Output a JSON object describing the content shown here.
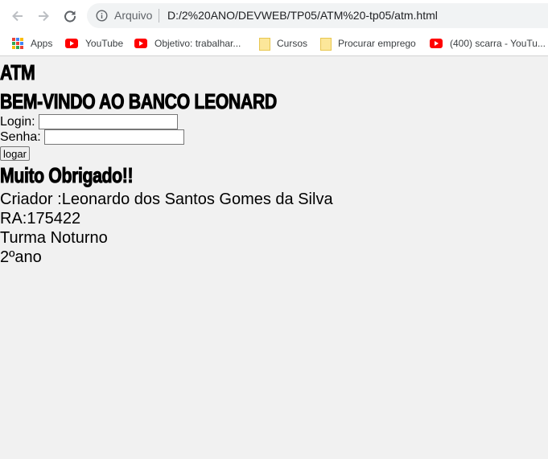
{
  "browser": {
    "scheme_label": "Arquivo",
    "url": "D:/2%20ANO/DEVWEB/TP05/ATM%20-tp05/atm.html",
    "bookmarks": [
      {
        "label": "Apps",
        "icon": "apps-grid-icon"
      },
      {
        "label": "YouTube",
        "icon": "youtube-icon"
      },
      {
        "label": "Objetivo: trabalhar...",
        "icon": "youtube-icon"
      },
      {
        "label": "Cursos",
        "icon": "folder-icon"
      },
      {
        "label": "Procurar emprego",
        "icon": "folder-icon"
      },
      {
        "label": "(400) scarra - YouTu...",
        "icon": "youtube-icon"
      }
    ]
  },
  "page": {
    "atm_title": "ATM",
    "welcome_title": "BEM-VINDO AO BANCO LEONARD",
    "login_label": "Login:",
    "login_value": "",
    "senha_label": "Senha:",
    "senha_value": "",
    "logar_label": "logar",
    "thanks_title": "Muito Obrigado!!",
    "info_lines": [
      "Criador :Leonardo dos Santos Gomes da Silva",
      "RA:175422",
      "Turma Noturno",
      "2ºano"
    ]
  },
  "colors": {
    "page_background": "#f1f1f1",
    "toolbar_background": "#ffffff",
    "omnibox_background": "#f1f3f4",
    "youtube_red": "#ff0000",
    "folder_yellow": "#fce79a"
  }
}
